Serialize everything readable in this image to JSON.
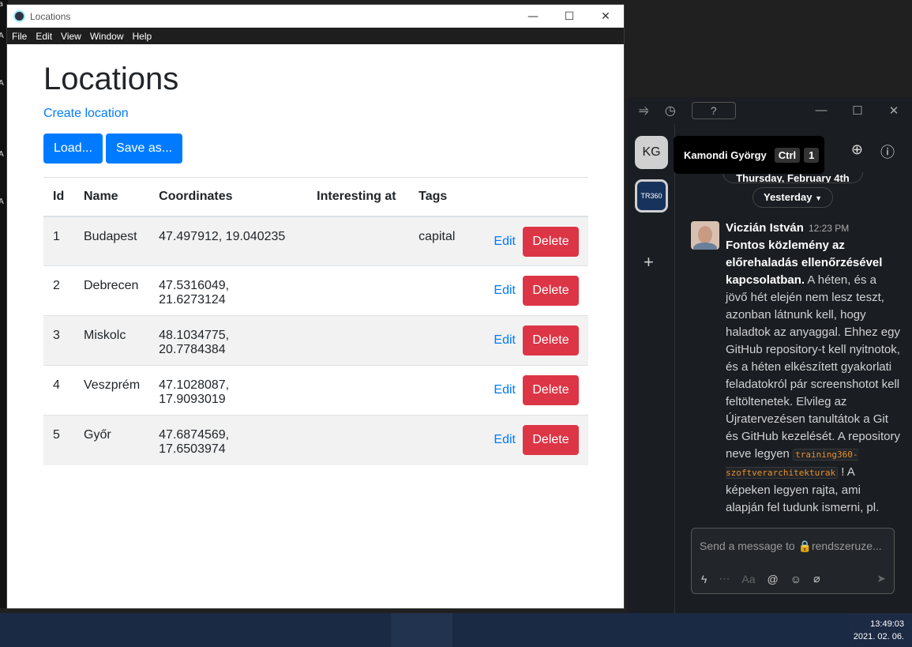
{
  "window": {
    "title": "Locations",
    "controls": [
      "—",
      "☐",
      "✕"
    ]
  },
  "menubar": [
    "File",
    "Edit",
    "View",
    "Window",
    "Help"
  ],
  "page": {
    "heading": "Locations",
    "create_link": "Create location",
    "load_button": "Load...",
    "save_button": "Save as..."
  },
  "table": {
    "headers": [
      "Id",
      "Name",
      "Coordinates",
      "Interesting at",
      "Tags"
    ],
    "edit_label": "Edit",
    "delete_label": "Delete",
    "rows": [
      {
        "id": "1",
        "name": "Budapest",
        "coords": "47.497912, 19.040235",
        "interesting": "",
        "tags": "capital"
      },
      {
        "id": "2",
        "name": "Debrecen",
        "coords": "47.5316049, 21.6273124",
        "interesting": "",
        "tags": ""
      },
      {
        "id": "3",
        "name": "Miskolc",
        "coords": "48.1034775, 20.7784384",
        "interesting": "",
        "tags": ""
      },
      {
        "id": "4",
        "name": "Veszprém",
        "coords": "47.1028087, 17.9093019",
        "interesting": "",
        "tags": ""
      },
      {
        "id": "5",
        "name": "Győr",
        "coords": "47.6874569, 17.6503974",
        "interesting": "",
        "tags": ""
      }
    ]
  },
  "chat": {
    "workspaces": {
      "kg": "KG",
      "tr": "TR360"
    },
    "tooltip": {
      "name": "Kamondi György",
      "key1": "Ctrl",
      "key2": "1"
    },
    "pill_prev": "Thursday, February 4th",
    "pill_yesterday": "Yesterday",
    "message": {
      "author": "Viczián István",
      "time": "12:23 PM",
      "bold_text": "Fontos közlemény az előrehaladás ellenőrzésével kapcsolatban.",
      "text": " A héten, és a jövő hét elején nem lesz teszt, azonban látnunk kell, hogy haladtok az anyaggal. Ehhez egy GitHub repository-t kell nyitnotok, és a héten elkészített gyakorlati feladatokról pár screenshotot kell feltöltenetek. Elvileg az Újratervezésen tanultátok a Git és GitHub kezelését. A repository neve legyen ",
      "code": "training360-szoftverarchitekturak",
      "text_after": " ! A képeken legyen rajta, ami alapján fel tudunk ismerni, pl."
    },
    "composer_placeholder": "Send a message to 🔒rendszeruze..."
  },
  "taskbar": {
    "time": "13:49:03",
    "date": "2021. 02. 06."
  }
}
